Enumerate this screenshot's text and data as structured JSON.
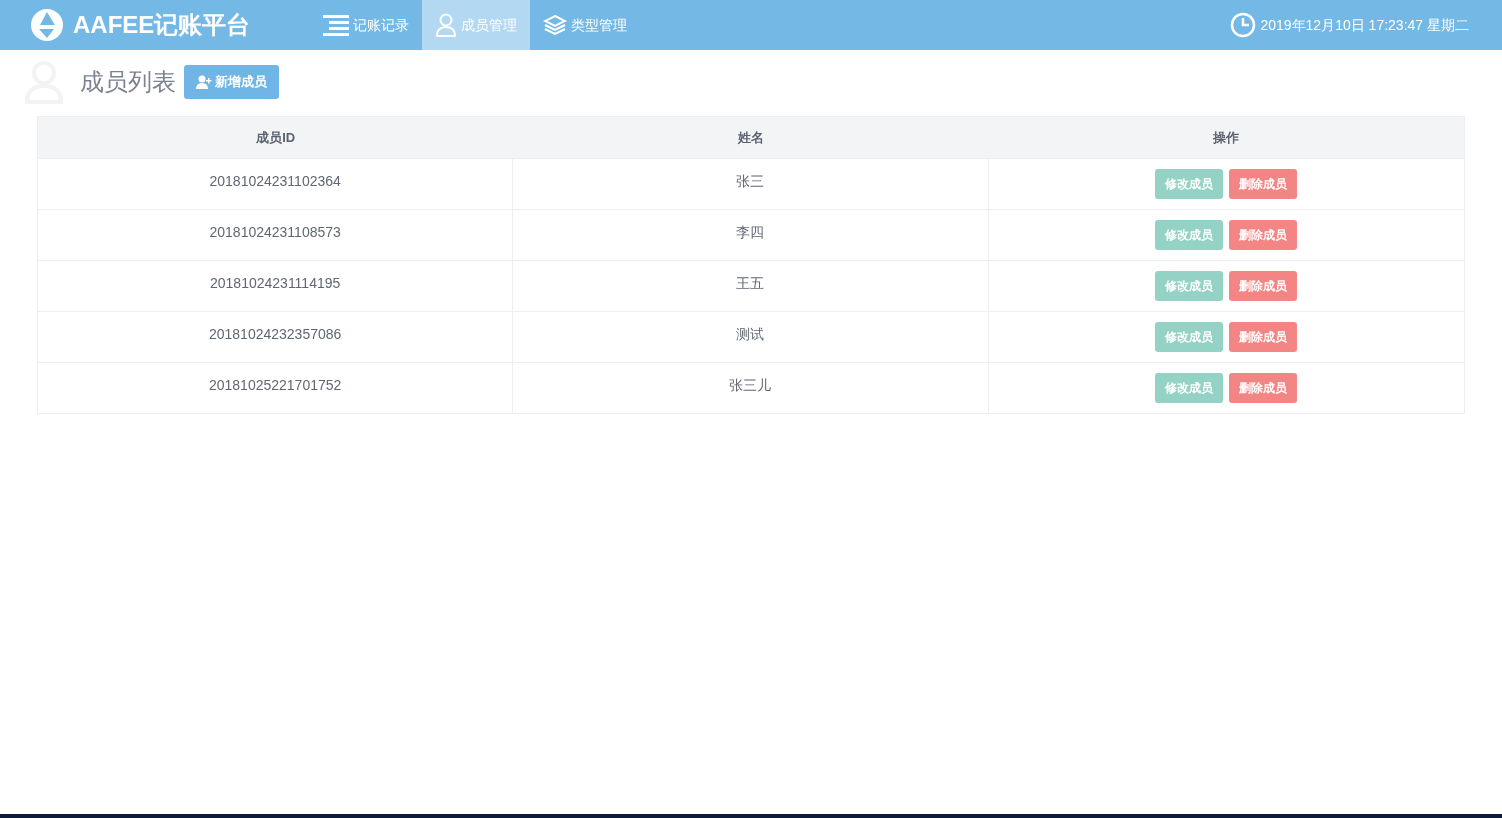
{
  "header": {
    "logo": "AAFEE记账平台",
    "nav": [
      {
        "label": "记账记录",
        "kind": "list",
        "selected": false
      },
      {
        "label": "成员管理",
        "kind": "user",
        "selected": true
      },
      {
        "label": "类型管理",
        "kind": "layers",
        "selected": false
      }
    ],
    "datetime": "2019年12月10日 17:23:47 星期二"
  },
  "page": {
    "title": "成员列表",
    "add_button": "新增成员"
  },
  "table": {
    "columns": [
      "成员ID",
      "姓名",
      "操作"
    ],
    "rows": [
      {
        "id": "20181024231102364",
        "name": "张三",
        "actions": [
          {
            "label": "修改成员",
            "kind": "edit"
          },
          {
            "label": "删除成员",
            "kind": "delete"
          }
        ]
      },
      {
        "id": "20181024231108573",
        "name": "李四",
        "actions": [
          {
            "label": "修改成员",
            "kind": "edit"
          },
          {
            "label": "删除成员",
            "kind": "delete"
          }
        ]
      },
      {
        "id": "20181024231114195",
        "name": "王五",
        "actions": [
          {
            "label": "修改成员",
            "kind": "edit"
          },
          {
            "label": "删除成员",
            "kind": "delete"
          }
        ]
      },
      {
        "id": "20181024232357086",
        "name": "测试",
        "actions": [
          {
            "label": "修改成员",
            "kind": "edit"
          },
          {
            "label": "删除成员",
            "kind": "delete"
          }
        ]
      },
      {
        "id": "20181025221701752",
        "name": "张三儿",
        "actions": [
          {
            "label": "修改成员",
            "kind": "edit"
          },
          {
            "label": "删除成员",
            "kind": "delete"
          }
        ]
      }
    ]
  }
}
